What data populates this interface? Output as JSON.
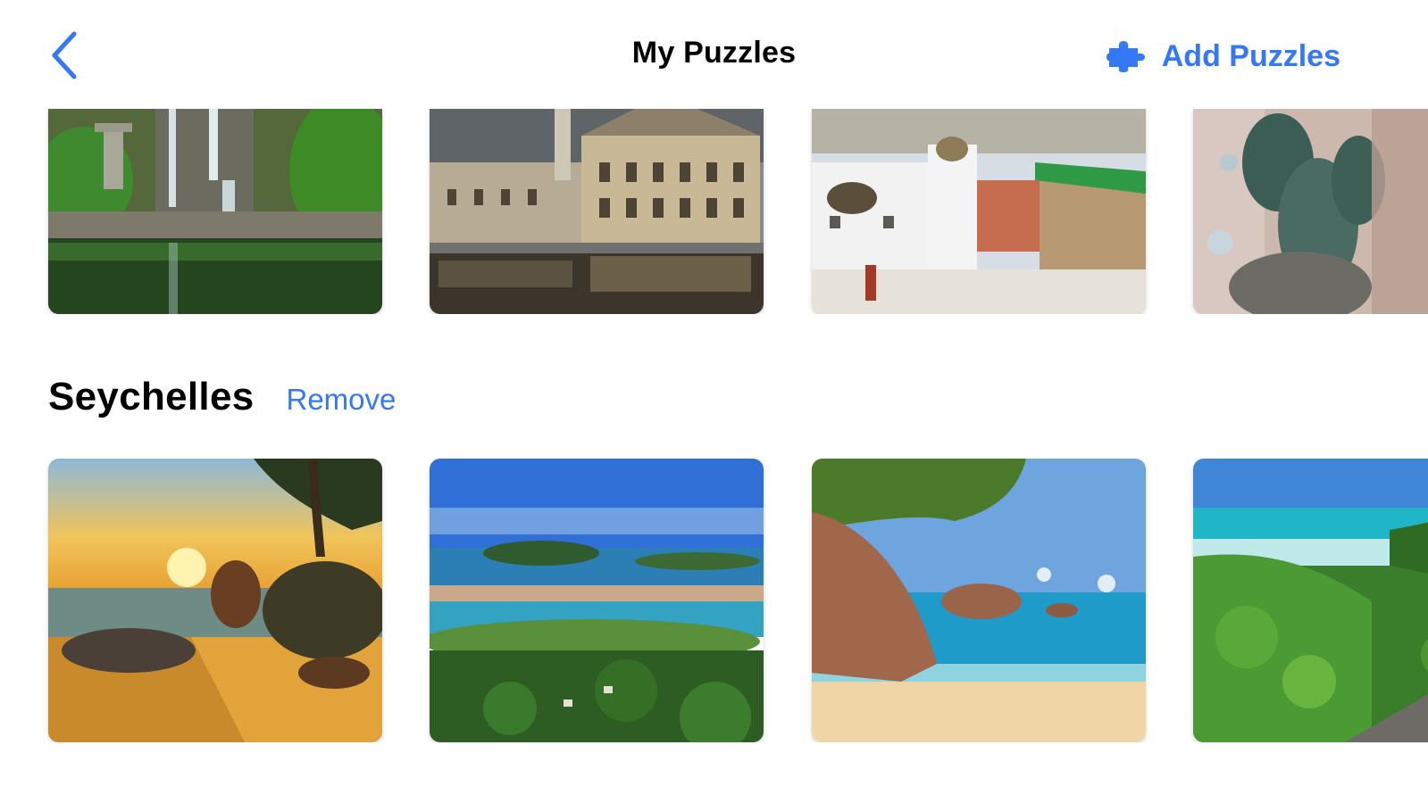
{
  "colors": {
    "accent": "#3478f6",
    "background": "#ffffff",
    "title": "#000000"
  },
  "navbar": {
    "back_icon": "chevron-left-icon",
    "title": "My Puzzles",
    "add_icon": "puzzle-piece-icon",
    "add_label": "Add Puzzles"
  },
  "collections": [
    {
      "title": "",
      "puzzles": [
        {
          "subject": "waterfall garden pond"
        },
        {
          "subject": "old town buildings on a canal"
        },
        {
          "subject": "snowy town with white church"
        },
        {
          "subject": "bronze fountain statue"
        }
      ]
    },
    {
      "title": "Seychelles",
      "remove_label": "Remove",
      "puzzles": [
        {
          "subject": "sunset beach with palm and rocks"
        },
        {
          "subject": "island lagoon bay aerial view"
        },
        {
          "subject": "granite boulders on a beach"
        },
        {
          "subject": "tropical palms above turquoise sea"
        }
      ]
    }
  ]
}
